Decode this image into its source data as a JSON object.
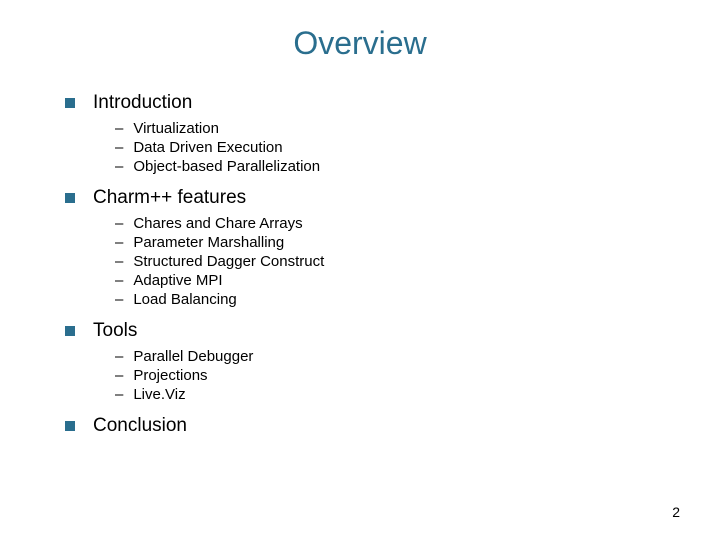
{
  "title": "Overview",
  "sections": [
    {
      "heading": "Introduction",
      "items": [
        "Virtualization",
        "Data Driven Execution",
        "Object-based Parallelization"
      ]
    },
    {
      "heading": "Charm++ features",
      "items": [
        "Chares and Chare Arrays",
        "Parameter Marshalling",
        "Structured Dagger Construct",
        "Adaptive MPI",
        "Load Balancing"
      ]
    },
    {
      "heading": "Tools",
      "items": [
        "Parallel Debugger",
        "Projections",
        "Live.Viz"
      ]
    },
    {
      "heading": "Conclusion",
      "items": []
    }
  ],
  "page_number": "2"
}
